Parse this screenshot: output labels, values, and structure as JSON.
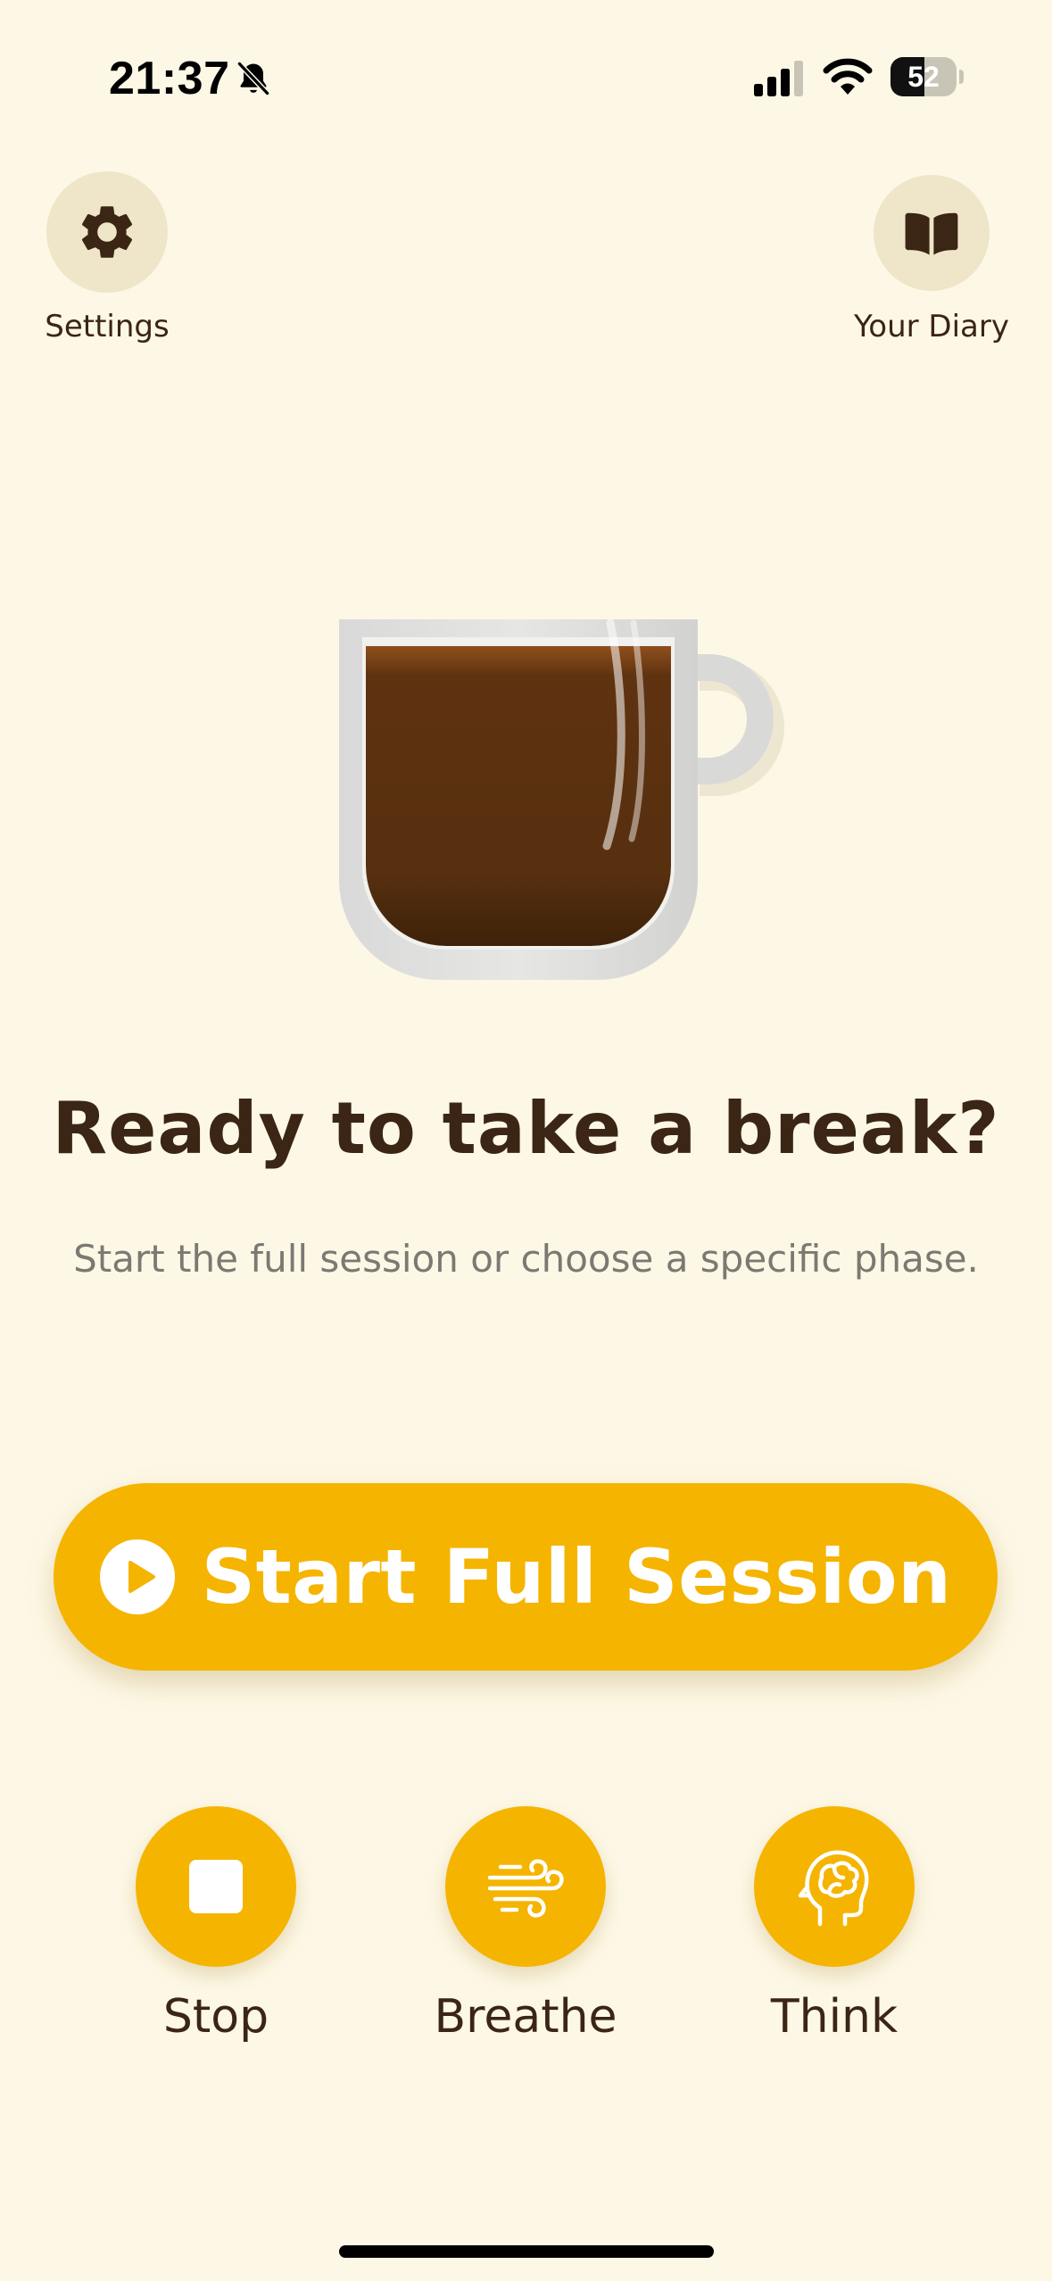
{
  "status_bar": {
    "time": "21:37",
    "battery_level": "52",
    "battery_fraction": 0.52,
    "icons": [
      "bell-slash-icon",
      "cellular-signal-icon",
      "wifi-icon",
      "battery-icon"
    ]
  },
  "nav": {
    "settings_label": "Settings",
    "settings_icon": "gear-icon",
    "diary_label": "Your Diary",
    "diary_icon": "open-book-icon"
  },
  "hero": {
    "illustration": "coffee-mug-illustration",
    "headline": "Ready to take a break?",
    "subline": "Start the full session or choose a specific phase."
  },
  "cta": {
    "label": "Start Full Session",
    "icon": "play-circle-icon"
  },
  "phases": [
    {
      "label": "Stop",
      "icon": "stop-square-icon"
    },
    {
      "label": "Breathe",
      "icon": "wind-icon"
    },
    {
      "label": "Think",
      "icon": "head-brain-icon"
    }
  ],
  "colors": {
    "background": "#fdf8e6",
    "accent": "#f5b400",
    "text_dark": "#3b2514",
    "text_muted": "#7d7872",
    "nav_circle": "#efe5c8"
  }
}
